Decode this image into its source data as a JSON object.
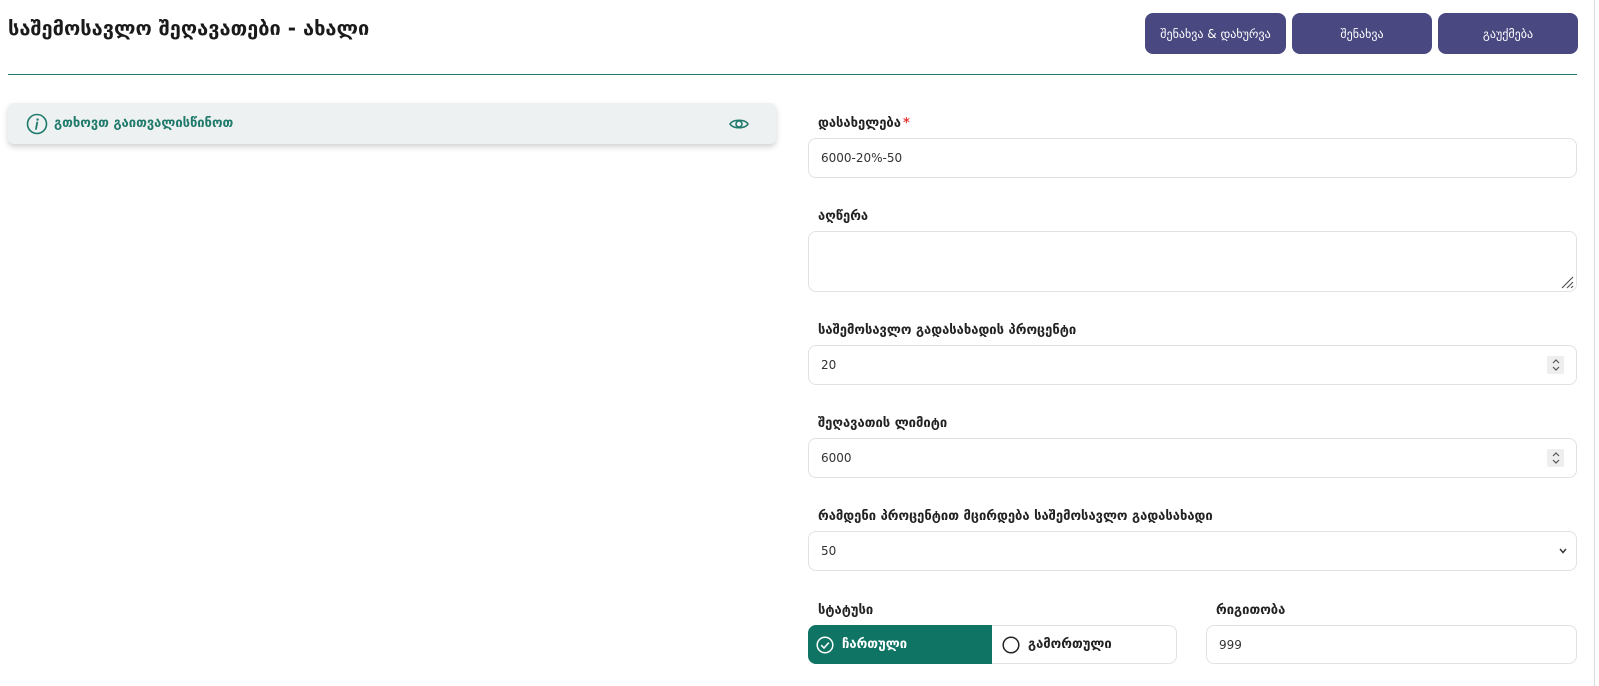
{
  "header": {
    "title": "საშემოსავლო შეღავათები - ახალი",
    "buttons": {
      "save_close": "შენახვა & დახურვა",
      "save": "შენახვა",
      "cancel": "გაუქმება"
    }
  },
  "notice": {
    "text": "გთხოვთ გაითვალისწინოთ"
  },
  "form": {
    "name": {
      "label": "დასახელება",
      "required_mark": "*",
      "value": "6000-20%-50"
    },
    "description": {
      "label": "აღწერა",
      "value": ""
    },
    "tax_percent": {
      "label": "საშემოსავლო გადასახადის პროცენტი",
      "value": "20"
    },
    "discount_limit": {
      "label": "შეღავათის ლიმიტი",
      "value": "6000"
    },
    "reduction_percent": {
      "label": "რამდენი პროცენტით მცირდება საშემოსავლო გადასახადი",
      "selected": "50"
    },
    "status": {
      "label": "სტატუსი",
      "on_label": "ჩართული",
      "off_label": "გამორთული",
      "selected": "ჩართული"
    },
    "order": {
      "label": "რიგითობა",
      "value": "999"
    }
  },
  "colors": {
    "primary_button": "#4a4880",
    "accent_teal": "#0f7464",
    "required": "#e53935"
  }
}
